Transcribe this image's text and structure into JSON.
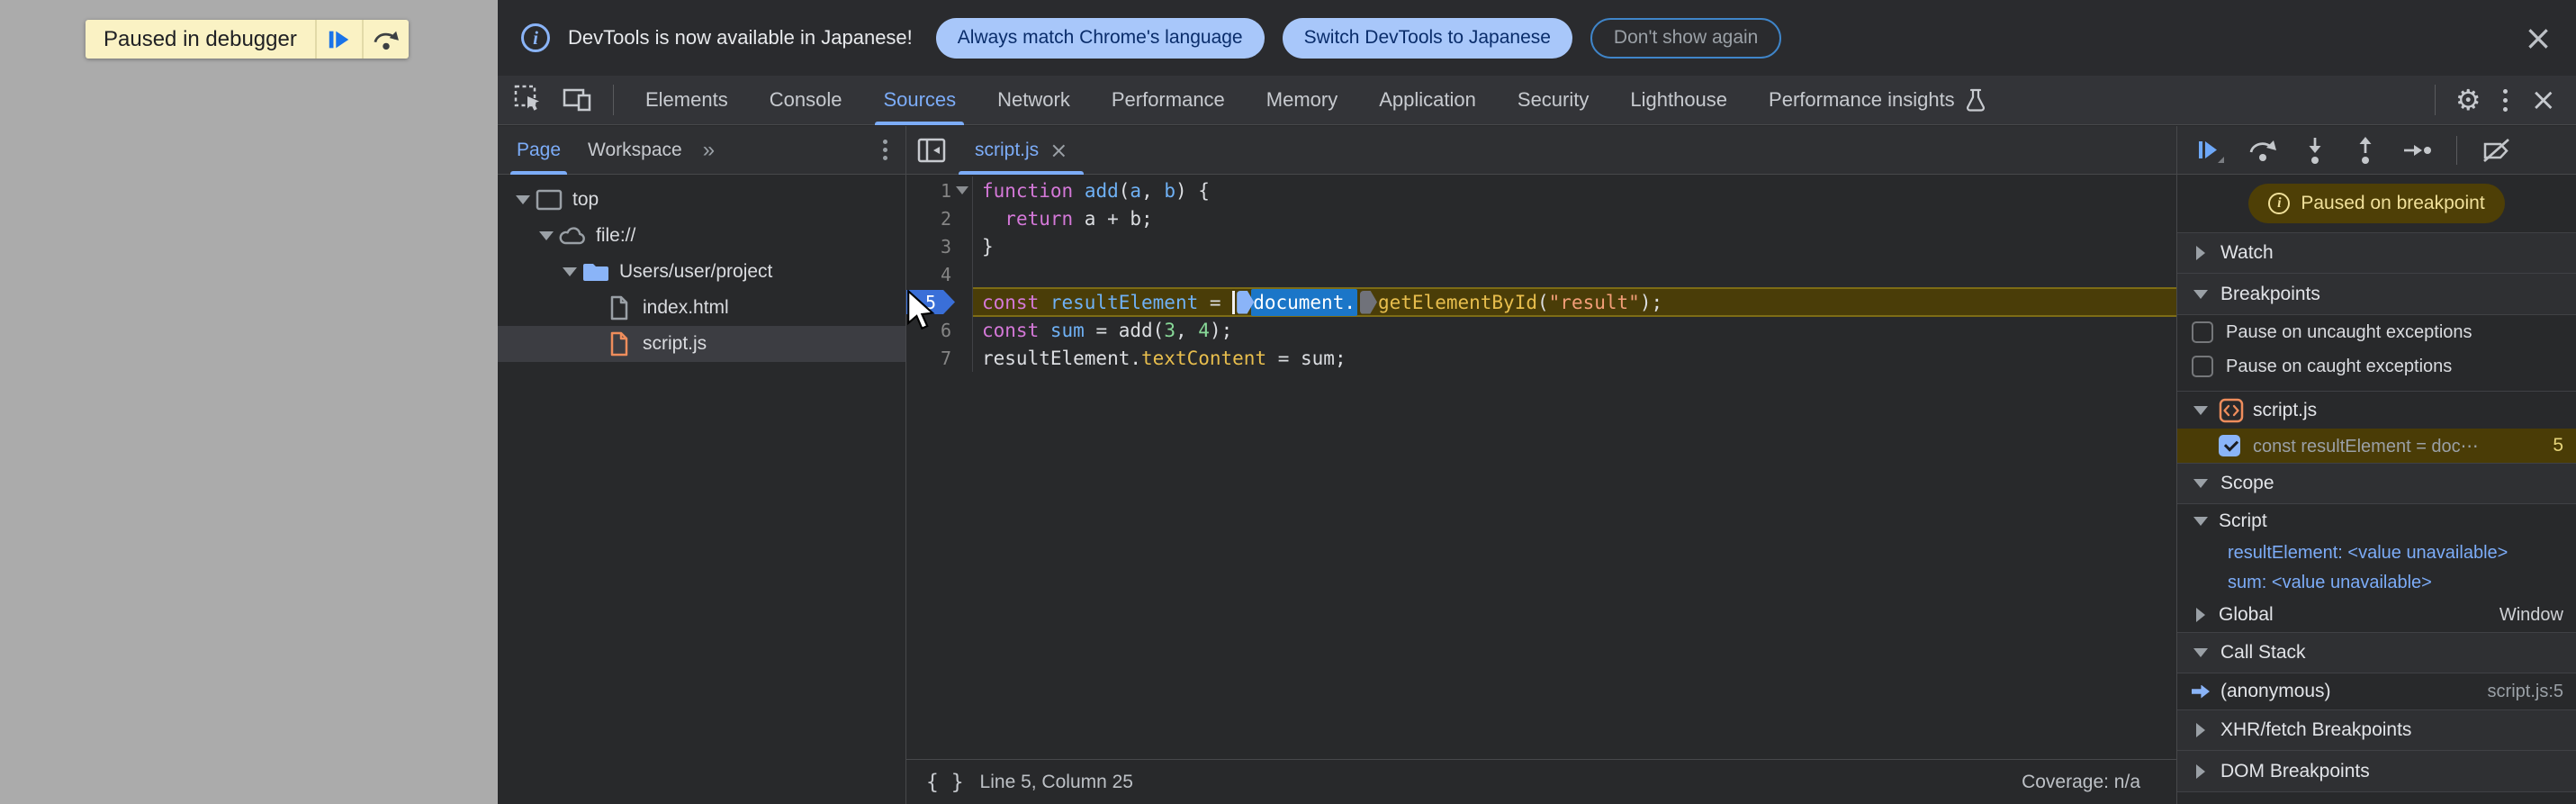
{
  "colors": {
    "page_gray": "#ababab",
    "banner_yellow": "#faf2c4",
    "devtools_bg": "#28292b",
    "toolbar_bg": "#333438",
    "accent_blue": "#7cacf8",
    "selection_blue": "#1b76c8",
    "exec_line_bg": "#4a3d08",
    "exec_badge_blue": "#3a6fd8",
    "paused_pill_bg": "#4e3f06",
    "paused_pill_text": "#f0e09a",
    "folder_blue": "#8ab4f8",
    "script_orange": "#ee8d5c",
    "keyword_purple": "#d478d8",
    "property_gold": "#e8be4d",
    "string_orange": "#f29e77",
    "number_green": "#88d998"
  },
  "page_overlay": {
    "paused_text": "Paused in debugger",
    "resume_icon": "resume-script-icon",
    "step_icon": "step-over-icon"
  },
  "notification": {
    "message": "DevTools is now available in Japanese!",
    "actions": [
      "Always match Chrome's language",
      "Switch DevTools to Japanese"
    ],
    "dismiss": "Don't show again",
    "close_icon": "close-icon"
  },
  "tabs": {
    "active": "Sources",
    "items": [
      "Elements",
      "Console",
      "Sources",
      "Network",
      "Performance",
      "Memory",
      "Application",
      "Security",
      "Lighthouse",
      "Performance insights"
    ]
  },
  "navigator": {
    "tabs": [
      "Page",
      "Workspace"
    ],
    "active": "Page",
    "more_tabs_chevrons": "»",
    "tree": [
      {
        "label": "top",
        "icon": "frame",
        "level": 0,
        "expanded": true
      },
      {
        "label": "file://",
        "icon": "cloud",
        "level": 1,
        "expanded": true
      },
      {
        "label": "Users/user/project",
        "icon": "folder",
        "level": 2,
        "expanded": true
      },
      {
        "label": "index.html",
        "icon": "file-gray",
        "level": 3
      },
      {
        "label": "script.js",
        "icon": "file-orange",
        "level": 3,
        "selected": true
      }
    ]
  },
  "editor": {
    "tab_label": "script.js",
    "lines": [
      {
        "num": "1",
        "fold": true,
        "tokens": [
          {
            "c": "kw",
            "t": "function"
          },
          {
            "c": "pl",
            "t": " "
          },
          {
            "c": "fn",
            "t": "add"
          },
          {
            "c": "pl",
            "t": "("
          },
          {
            "c": "var",
            "t": "a"
          },
          {
            "c": "pl",
            "t": ", "
          },
          {
            "c": "var",
            "t": "b"
          },
          {
            "c": "pl",
            "t": ") {"
          }
        ]
      },
      {
        "num": "2",
        "tokens": [
          {
            "c": "pl",
            "t": "  "
          },
          {
            "c": "kw",
            "t": "return"
          },
          {
            "c": "pl",
            "t": " a + b;"
          }
        ]
      },
      {
        "num": "3",
        "tokens": [
          {
            "c": "pl",
            "t": "}"
          }
        ]
      },
      {
        "num": "4",
        "tokens": []
      },
      {
        "num": "5",
        "current": true,
        "tokens": [
          {
            "c": "kw",
            "t": "const"
          },
          {
            "c": "pl",
            "t": " "
          },
          {
            "c": "var",
            "t": "resultElement"
          },
          {
            "c": "pl",
            "t": " = "
          },
          {
            "c": "caret",
            "t": ""
          },
          {
            "c": "marker-blue",
            "t": ""
          },
          {
            "c": "sel",
            "t": "document."
          },
          {
            "c": "marker-dark",
            "t": ""
          },
          {
            "c": "prop",
            "t": "getElementById"
          },
          {
            "c": "pl",
            "t": "("
          },
          {
            "c": "str",
            "t": "\"result\""
          },
          {
            "c": "pl",
            "t": ");"
          }
        ]
      },
      {
        "num": "6",
        "tokens": [
          {
            "c": "kw",
            "t": "const"
          },
          {
            "c": "pl",
            "t": " "
          },
          {
            "c": "var",
            "t": "sum"
          },
          {
            "c": "pl",
            "t": " = add("
          },
          {
            "c": "num",
            "t": "3"
          },
          {
            "c": "pl",
            "t": ", "
          },
          {
            "c": "num",
            "t": "4"
          },
          {
            "c": "pl",
            "t": ");"
          }
        ]
      },
      {
        "num": "7",
        "tokens": [
          {
            "c": "pl",
            "t": "resultElement."
          },
          {
            "c": "prop",
            "t": "textContent"
          },
          {
            "c": "pl",
            "t": " = sum;"
          }
        ]
      }
    ],
    "status": {
      "position": "Line 5, Column 25",
      "coverage": "Coverage: n/a",
      "braces_icon": "{ }"
    }
  },
  "debugger": {
    "toolbar_icons": [
      "resume-icon",
      "step-over-icon",
      "step-into-icon",
      "step-out-icon",
      "step-icon",
      "deactivate-breakpoints-icon"
    ],
    "paused_badge": "Paused on breakpoint",
    "sections": [
      {
        "type": "header",
        "label": "Watch",
        "expanded": false
      },
      {
        "type": "header",
        "label": "Breakpoints",
        "expanded": true
      },
      {
        "type": "checkbox",
        "label": "Pause on uncaught exceptions",
        "checked": false
      },
      {
        "type": "checkbox",
        "label": "Pause on caught exceptions",
        "checked": false
      },
      {
        "type": "file-group",
        "label": "script.js",
        "expanded": true,
        "icon": "code-file-orange"
      },
      {
        "type": "breakpoint",
        "label": "const resultElement = doc⋯",
        "line": "5",
        "checked": true
      },
      {
        "type": "header",
        "label": "Scope",
        "expanded": true
      },
      {
        "type": "scope-sub",
        "label": "Script",
        "expanded": true
      },
      {
        "type": "scope-var",
        "name": "resultElement",
        "value": "<value unavailable>"
      },
      {
        "type": "scope-var",
        "name": "sum",
        "value": "<value unavailable>"
      },
      {
        "type": "scope-row",
        "label": "Global",
        "right": "Window",
        "expanded": false
      },
      {
        "type": "header",
        "label": "Call Stack",
        "expanded": true
      },
      {
        "type": "stack-frame",
        "label": "(anonymous)",
        "right": "script.js:5",
        "current": true
      },
      {
        "type": "header",
        "label": "XHR/fetch Breakpoints",
        "expanded": false
      },
      {
        "type": "header",
        "label": "DOM Breakpoints",
        "expanded": false
      }
    ]
  }
}
